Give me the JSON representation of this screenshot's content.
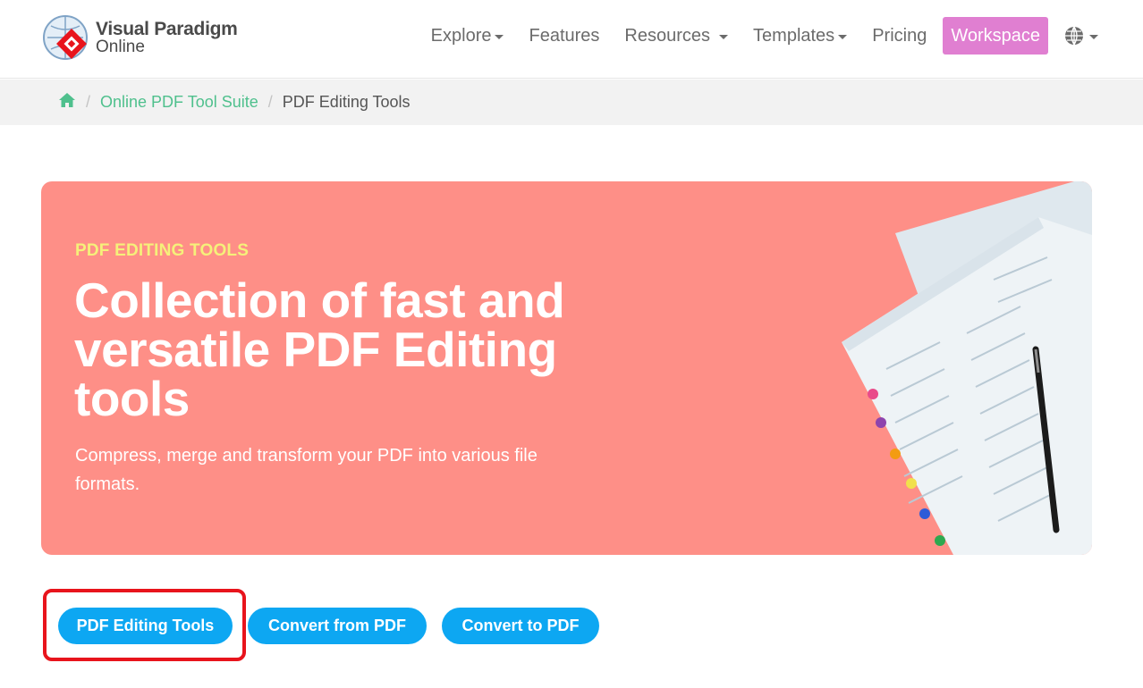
{
  "brand": {
    "line1": "Visual Paradigm",
    "line2": "Online",
    "accent_color": "#e8141c"
  },
  "nav": {
    "items": [
      {
        "label": "Explore",
        "dropdown": true
      },
      {
        "label": "Features",
        "dropdown": false
      },
      {
        "label": "Resources",
        "dropdown": true
      },
      {
        "label": "Templates",
        "dropdown": true
      },
      {
        "label": "Pricing",
        "dropdown": false
      }
    ],
    "workspace_label": "Workspace",
    "workspace_color": "#e07fd1",
    "language_icon": "globe-icon"
  },
  "breadcrumb": {
    "home_icon": "home-icon",
    "link": "Online PDF Tool Suite",
    "separator": "/",
    "current": "PDF Editing Tools",
    "link_color": "#4fc08d"
  },
  "hero": {
    "kicker": "PDF EDITING TOOLS",
    "title": "Collection of fast and versatile PDF Editing tools",
    "description": "Compress, merge and transform your PDF into various file formats.",
    "background_color": "#fe8f87",
    "kicker_color": "#f5f07a"
  },
  "tabs": [
    {
      "label": "PDF Editing Tools",
      "selected": true
    },
    {
      "label": "Convert from PDF",
      "selected": false
    },
    {
      "label": "Convert to PDF",
      "selected": false
    }
  ],
  "tab_color": "#0da7f2",
  "highlight_color": "#e8141c"
}
